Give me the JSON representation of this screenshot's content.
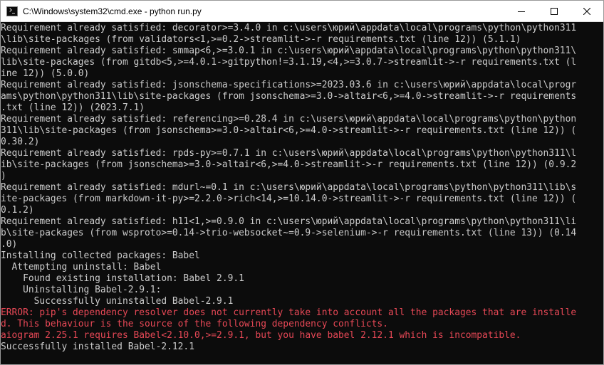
{
  "window": {
    "title": "C:\\Windows\\system32\\cmd.exe - python  run.py",
    "icon": "cmd-icon",
    "controls": [
      "minimize-icon",
      "maximize-icon",
      "close-icon"
    ]
  },
  "colors": {
    "console_bg": "#0c0c0c",
    "console_text": "#cccccc",
    "error_text": "#e74856",
    "titlebar_bg": "#ffffff"
  },
  "console": {
    "lines": [
      {
        "text": "Requirement already satisfied: decorator>=3.4.0 in c:\\users\\юрий\\appdata\\local\\programs\\python\\python311",
        "type": "normal"
      },
      {
        "text": "\\lib\\site-packages (from validators<1,>=0.2->streamlit->-r requirements.txt (line 12)) (5.1.1)",
        "type": "normal"
      },
      {
        "text": "Requirement already satisfied: smmap<6,>=3.0.1 in c:\\users\\юрий\\appdata\\local\\programs\\python\\python311\\",
        "type": "normal"
      },
      {
        "text": "lib\\site-packages (from gitdb<5,>=4.0.1->gitpython!=3.1.19,<4,>=3.0.7->streamlit->-r requirements.txt (l",
        "type": "normal"
      },
      {
        "text": "ine 12)) (5.0.0)",
        "type": "normal"
      },
      {
        "text": "Requirement already satisfied: jsonschema-specifications>=2023.03.6 in c:\\users\\юрий\\appdata\\local\\progr",
        "type": "normal"
      },
      {
        "text": "ams\\python\\python311\\lib\\site-packages (from jsonschema>=3.0->altair<6,>=4.0->streamlit->-r requirements",
        "type": "normal"
      },
      {
        "text": ".txt (line 12)) (2023.7.1)",
        "type": "normal"
      },
      {
        "text": "Requirement already satisfied: referencing>=0.28.4 in c:\\users\\юрий\\appdata\\local\\programs\\python\\python",
        "type": "normal"
      },
      {
        "text": "311\\lib\\site-packages (from jsonschema>=3.0->altair<6,>=4.0->streamlit->-r requirements.txt (line 12)) (",
        "type": "normal"
      },
      {
        "text": "0.30.2)",
        "type": "normal"
      },
      {
        "text": "Requirement already satisfied: rpds-py>=0.7.1 in c:\\users\\юрий\\appdata\\local\\programs\\python\\python311\\l",
        "type": "normal"
      },
      {
        "text": "ib\\site-packages (from jsonschema>=3.0->altair<6,>=4.0->streamlit->-r requirements.txt (line 12)) (0.9.2",
        "type": "normal"
      },
      {
        "text": ")",
        "type": "normal"
      },
      {
        "text": "Requirement already satisfied: mdurl~=0.1 in c:\\users\\юрий\\appdata\\local\\programs\\python\\python311\\lib\\s",
        "type": "normal"
      },
      {
        "text": "ite-packages (from markdown-it-py>=2.2.0->rich<14,>=10.14.0->streamlit->-r requirements.txt (line 12)) (",
        "type": "normal"
      },
      {
        "text": "0.1.2)",
        "type": "normal"
      },
      {
        "text": "Requirement already satisfied: h11<1,>=0.9.0 in c:\\users\\юрий\\appdata\\local\\programs\\python\\python311\\li",
        "type": "normal"
      },
      {
        "text": "b\\site-packages (from wsproto>=0.14->trio-websocket~=0.9->selenium->-r requirements.txt (line 13)) (0.14",
        "type": "normal"
      },
      {
        "text": ".0)",
        "type": "normal"
      },
      {
        "text": "Installing collected packages: Babel",
        "type": "normal"
      },
      {
        "text": "  Attempting uninstall: Babel",
        "type": "normal"
      },
      {
        "text": "    Found existing installation: Babel 2.9.1",
        "type": "normal"
      },
      {
        "text": "    Uninstalling Babel-2.9.1:",
        "type": "normal"
      },
      {
        "text": "      Successfully uninstalled Babel-2.9.1",
        "type": "normal"
      },
      {
        "text": "ERROR: pip's dependency resolver does not currently take into account all the packages that are installe",
        "type": "error"
      },
      {
        "text": "d. This behaviour is the source of the following dependency conflicts.",
        "type": "error"
      },
      {
        "text": "aiogram 2.25.1 requires Babel<2.10.0,>=2.9.1, but you have babel 2.12.1 which is incompatible.",
        "type": "error"
      },
      {
        "text": "Successfully installed Babel-2.12.1",
        "type": "normal"
      }
    ]
  }
}
